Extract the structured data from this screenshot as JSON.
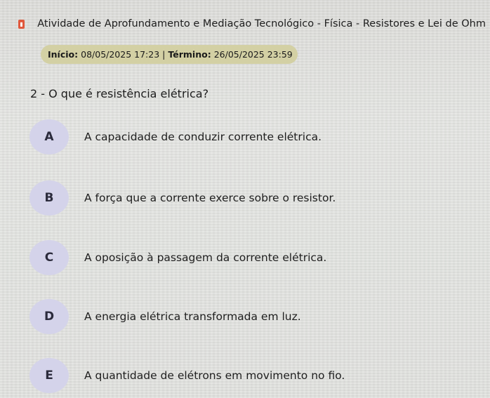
{
  "header": {
    "icon": "book-icon",
    "title": "Atividade de Aprofundamento e Mediação Tecnológico - Física - Resistores e Lei de Ohm"
  },
  "dates": {
    "start_label": "Início:",
    "start_value": "08/05/2025 17:23",
    "separator": "|",
    "end_label": "Término:",
    "end_value": "26/05/2025 23:59"
  },
  "question": {
    "text": "2 - O que é resistência elétrica?"
  },
  "options": [
    {
      "letter": "A",
      "text": "A capacidade de conduzir corrente elétrica."
    },
    {
      "letter": "B",
      "text": "A força que a corrente exerce sobre o resistor."
    },
    {
      "letter": "C",
      "text": "A oposição à passagem da corrente elétrica."
    },
    {
      "letter": "D",
      "text": "A energia elétrica transformada em luz."
    },
    {
      "letter": "E",
      "text": "A quantidade de elétrons em movimento no fio."
    }
  ],
  "colors": {
    "date_pill": "#d3d0a4",
    "option_circle": "#d4d3ea",
    "icon_accent": "#e0583c"
  }
}
